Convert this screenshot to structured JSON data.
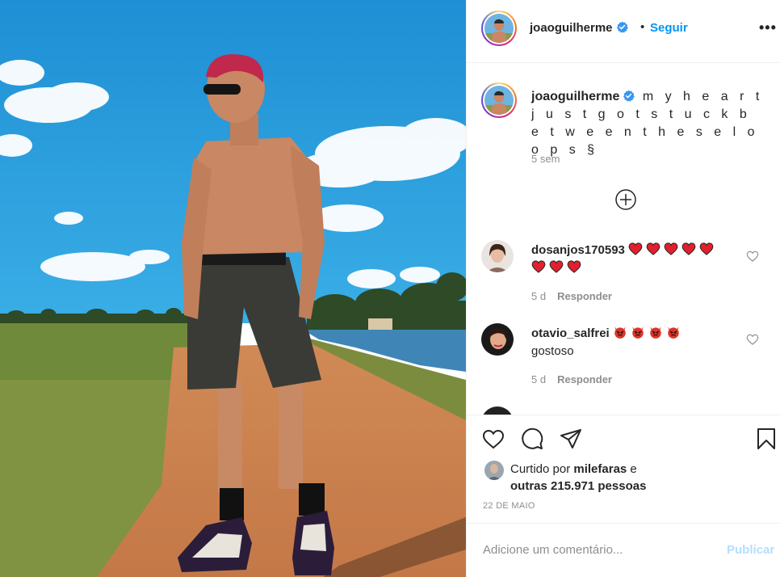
{
  "post": {
    "author": "joaoguilherme",
    "follow_label": "Seguir",
    "separator": "•",
    "more_label": "•••",
    "caption": "m y h e a r t j u s t g o t s t u c k b e t w e e n t h e s e l o o p s",
    "caption_emoji": "§",
    "caption_time": "5 sem",
    "likes_prefix": "Curtido por",
    "liked_by_user": "milefaras",
    "likes_connector": "e",
    "likes_others": "outras 215.971 pessoas",
    "date": "22 DE MAIO"
  },
  "comments": [
    {
      "user": "dosanjos170593",
      "emoji": "heart",
      "emoji_count": 8,
      "text": "",
      "time": "5 d",
      "reply_label": "Responder"
    },
    {
      "user": "otavio_salfrei",
      "emoji": "devil",
      "emoji_count": 4,
      "text": "gostoso",
      "time": "5 d",
      "reply_label": "Responder"
    }
  ],
  "add_comment": {
    "placeholder": "Adicione um comentário...",
    "publish_label": "Publicar"
  },
  "icons": [
    "verified-badge-icon",
    "more-options-icon",
    "load-more-comments-icon",
    "like-heart-icon",
    "comment-bubble-icon",
    "share-paper-plane-icon",
    "save-bookmark-icon"
  ],
  "colors": {
    "link_blue": "#0095f6",
    "publish_disabled": "#b2dffc",
    "muted_text": "#8e8e8e",
    "heart_red": "#e0202f",
    "devil_red": "#d9362b"
  }
}
